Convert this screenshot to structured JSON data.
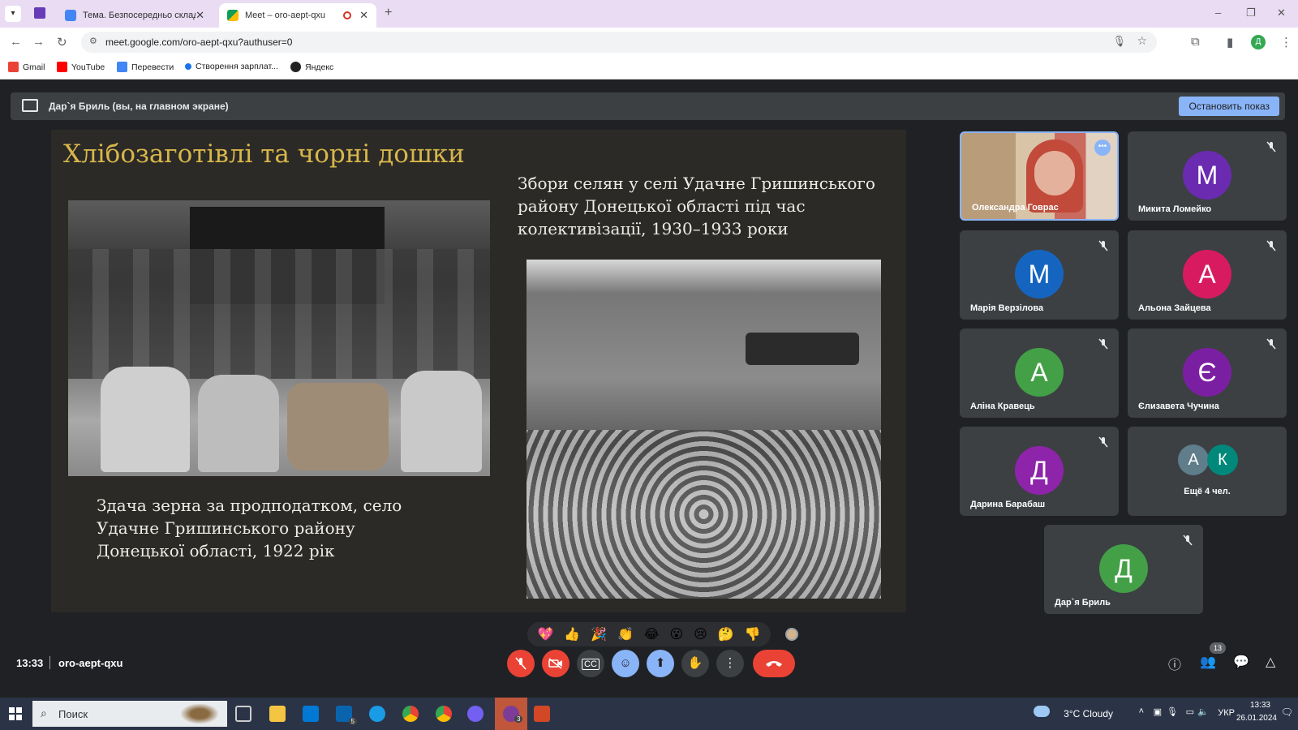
{
  "browser": {
    "tabs": [
      {
        "label": "Тема. Безпосередньо склад",
        "active": false
      },
      {
        "label": "Meet – oro-aept-qxu",
        "active": true
      }
    ],
    "url": "meet.google.com/oro-aept-qxu?authuser=0",
    "bookmarks": [
      "Gmail",
      "YouTube",
      "Перевести",
      "Створення зарплат...",
      "Яндекс"
    ]
  },
  "presentation_bar": {
    "label": "Дар`я Бриль (вы, на главном экране)",
    "stop_button": "Остановить показ"
  },
  "slide": {
    "title": "Хлібозаготівлі та чорні дошки",
    "caption_right": [
      "Збори селян у селі Удачне Гришинського",
      "району Донецької області під час",
      "колективізації, 1930–1933 роки"
    ],
    "caption_left": [
      "Здача зерна за продподатком, село",
      "Удачне Гришинського району",
      "Донецької області, 1922 рік"
    ]
  },
  "participants": [
    {
      "name": "Олександра Говрас",
      "initial": "",
      "color": "#5b6e80",
      "muted": false,
      "speaking": true
    },
    {
      "name": "Микита Ломейко",
      "initial": "М",
      "color": "#6a2bb0",
      "muted": true
    },
    {
      "name": "Марія Верзілова",
      "initial": "М",
      "color": "#1565c0",
      "muted": true
    },
    {
      "name": "Альона Зайцева",
      "initial": "А",
      "color": "#d81b60",
      "muted": true
    },
    {
      "name": "Аліна Кравець",
      "initial": "А",
      "color": "#43a047",
      "muted": true
    },
    {
      "name": "Єлизавета Чучина",
      "initial": "Є",
      "color": "#7b1fa2",
      "muted": true
    },
    {
      "name": "Дарина Барабаш",
      "initial": "Д",
      "color": "#8e24aa",
      "muted": true
    },
    {
      "name": "Ещё 4 чел.",
      "initial": "",
      "avatars": [
        "А",
        "К"
      ],
      "color": "#5f6368",
      "muted": false
    },
    {
      "name": "Дар`я Бриль",
      "initial": "Д",
      "color": "#43a047",
      "muted": true
    }
  ],
  "reactions": [
    "💖",
    "👍",
    "🎉",
    "👏",
    "😂",
    "😮",
    "😢",
    "🤔",
    "👎"
  ],
  "meeting": {
    "time": "13:33",
    "code": "oro-aept-qxu",
    "participant_count": "13"
  },
  "taskbar": {
    "search_placeholder": "Поиск",
    "weather": "3°C  Cloudy",
    "language": "УКР",
    "clock_time": "13:33",
    "clock_date": "26.01.2024",
    "badges": {
      "mail": "5",
      "viber": "3"
    }
  }
}
